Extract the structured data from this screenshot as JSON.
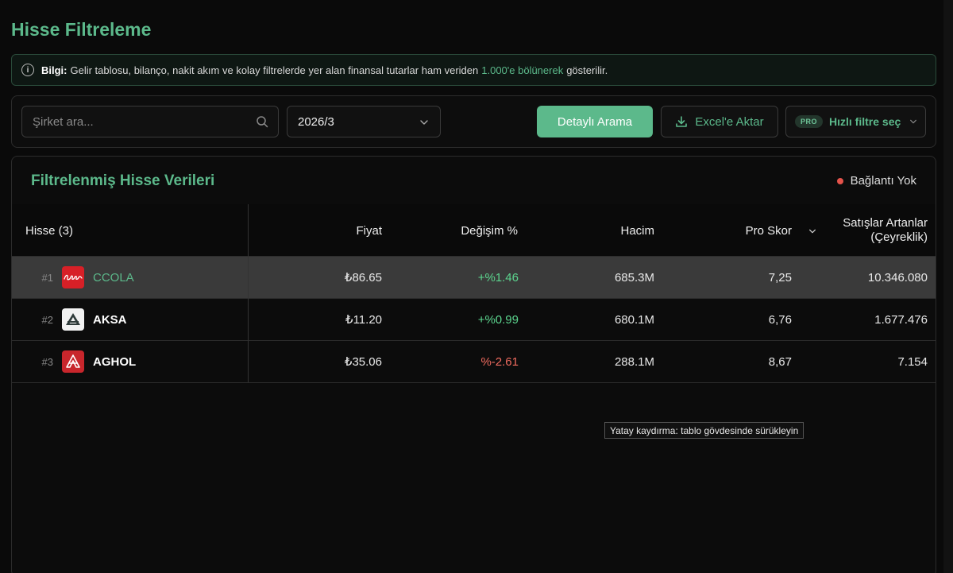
{
  "page": {
    "title": "Hisse Filtreleme"
  },
  "info": {
    "label": "Bilgi:",
    "text_before": "Gelir tablosu, bilanço, nakit akım ve kolay filtrelerde yer alan finansal tutarlar ham veriden",
    "highlight": "1.000'e bölünerek",
    "text_after": "gösterilir."
  },
  "toolbar": {
    "search_placeholder": "Şirket ara...",
    "period_value": "2026/3",
    "detail_button": "Detaylı Arama",
    "excel_button": "Excel'e Aktar",
    "pro_badge": "PRO",
    "quick_filter": "Hızlı filtre seç"
  },
  "panel": {
    "title": "Filtrelenmiş Hisse Verileri",
    "status": "Bağlantı Yok"
  },
  "table": {
    "columns": {
      "stock": "Hisse (3)",
      "price": "Fiyat",
      "change": "Değişim %",
      "volume": "Hacim",
      "score": "Pro Skor",
      "sales_line1": "Satışlar Artanlar",
      "sales_line2": "(Çeyreklik)"
    },
    "rows": [
      {
        "rank": "#1",
        "ticker": "CCOLA",
        "price": "₺86.65",
        "change": "+%1.46",
        "volume": "685.3M",
        "score": "7,25",
        "sales": "10.346.080"
      },
      {
        "rank": "#2",
        "ticker": "AKSA",
        "price": "₺11.20",
        "change": "+%0.99",
        "volume": "680.1M",
        "score": "6,76",
        "sales": "1.677.476"
      },
      {
        "rank": "#3",
        "ticker": "AGHOL",
        "price": "₺35.06",
        "change": "%-2.61",
        "volume": "288.1M",
        "score": "8,67",
        "sales": "7.154"
      }
    ]
  },
  "tooltip": "Yatay kaydırma: tablo gövdesinde sürükleyin",
  "colors": {
    "accent": "#5cb98b",
    "positive": "#5cd68f",
    "negative": "#f06b5f",
    "status_offline": "#e5534b"
  }
}
